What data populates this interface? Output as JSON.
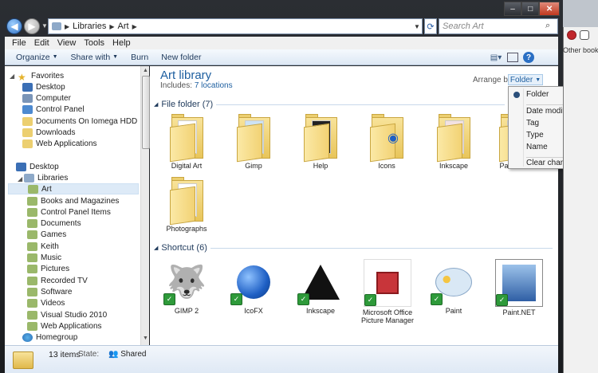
{
  "window": {
    "min": "–",
    "max": "□",
    "close": "✕"
  },
  "nav": {
    "crumbs": [
      "Libraries",
      "Art"
    ],
    "refresh": "⟳",
    "search_placeholder": "Search Art",
    "search_icon": "⌕"
  },
  "menubar": [
    "File",
    "Edit",
    "View",
    "Tools",
    "Help"
  ],
  "toolbar": {
    "organize": "Organize",
    "share": "Share with",
    "burn": "Burn",
    "newfolder": "New folder"
  },
  "navpane": {
    "favorites": {
      "label": "Favorites",
      "items": [
        "Desktop",
        "Computer",
        "Control Panel",
        "Documents On Iomega HDD",
        "Downloads",
        "Web Applications"
      ]
    },
    "desktop": "Desktop",
    "libraries": "Libraries",
    "libitems": [
      "Art",
      "Books and Magazines",
      "Control Panel Items",
      "Documents",
      "Games",
      "Keith",
      "Music",
      "Pictures",
      "Recorded TV",
      "Software",
      "Videos",
      "Visual Studio 2010",
      "Web Applications"
    ],
    "homegroup": "Homegroup"
  },
  "library": {
    "title": "Art library",
    "includes_label": "Includes:",
    "includes_link": "7 locations",
    "arrange_label": "Arrange by:",
    "arrange_value": "Folder"
  },
  "groups": {
    "folders": "File folder (7)",
    "shortcuts": "Shortcut (6)"
  },
  "folders": [
    "Digital Art",
    "Gimp",
    "Help",
    "Icons",
    "Inkscape",
    "Paint.NET",
    "Photographs"
  ],
  "shortcuts": [
    "GIMP 2",
    "IcoFX",
    "Inkscape",
    "Microsoft Office Picture Manager",
    "Paint",
    "Paint.NET"
  ],
  "popup": {
    "items": [
      "Folder",
      "Date modified",
      "Tag",
      "Type",
      "Name",
      "Clear changes"
    ]
  },
  "status": {
    "count": "13 items",
    "state_label": "State:",
    "state_value": "Shared"
  },
  "browser": {
    "other": "Other bookm"
  },
  "colors": {
    "accent": "#1e5fa0",
    "folder": "#f2d274",
    "check": "#2e9a3a"
  }
}
